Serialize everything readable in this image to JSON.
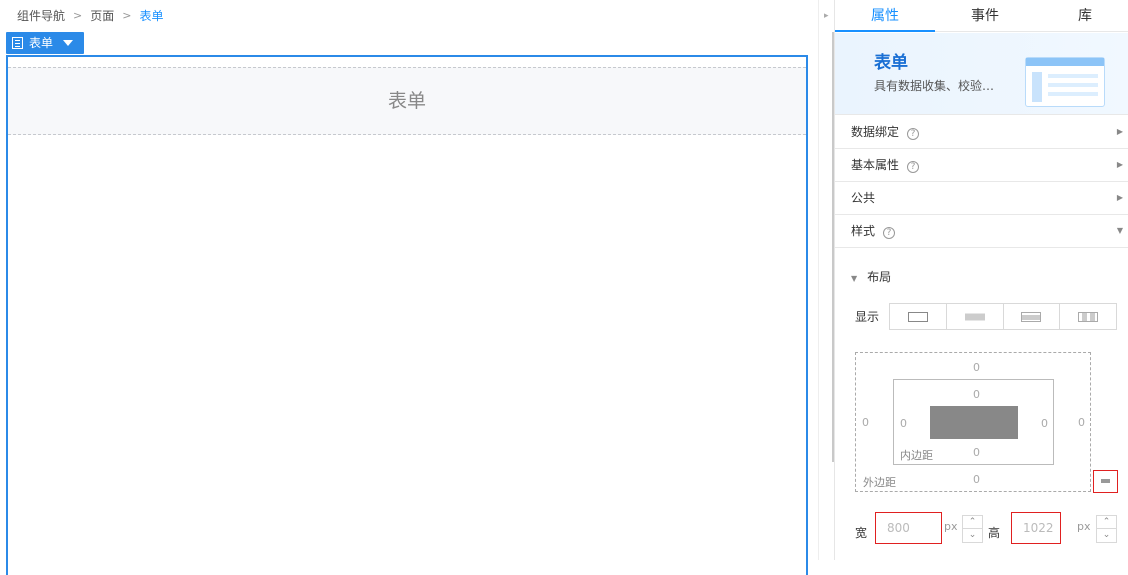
{
  "breadcrumb": {
    "items": [
      "组件导航",
      "页面",
      "表单"
    ]
  },
  "component_tag": {
    "label": "表单"
  },
  "canvas": {
    "form_title": "表单"
  },
  "panel": {
    "tabs": [
      "属性",
      "事件",
      "库"
    ],
    "active_tab": "属性",
    "banner": {
      "title": "表单",
      "desc": "具有数据收集、校验…"
    },
    "sections": [
      {
        "label": "数据绑定",
        "help": true,
        "expanded": false
      },
      {
        "label": "基本属性",
        "help": true,
        "expanded": false
      },
      {
        "label": "公共",
        "help": false,
        "expanded": false
      },
      {
        "label": "样式",
        "help": true,
        "expanded": true
      }
    ],
    "layout": {
      "title": "布局",
      "display_label": "显示",
      "margin": {
        "label": "外边距",
        "top": "0",
        "right": "0",
        "bottom": "0",
        "left": "0"
      },
      "padding": {
        "label": "内边距",
        "top": "0",
        "right": "0",
        "bottom": "0",
        "left": "0"
      },
      "width": {
        "label": "宽",
        "value": "800",
        "unit": "px"
      },
      "height": {
        "label": "高",
        "value": "1022",
        "unit": "px"
      }
    }
  },
  "colors": {
    "accent": "#1890ff",
    "tag_bg": "#2b8ae8",
    "highlight": "#e02020"
  },
  "icons": {
    "breadcrumb_sep": "chevron-right-icon",
    "tag": "form-icon",
    "tag_caret": "caret-down-icon",
    "help": "question-circle-icon",
    "collapse": "chevron-right-icon",
    "expand": "chevron-down-icon",
    "lock": "lock-icon",
    "display_modes": [
      "block-icon",
      "inline-icon",
      "inline-block-icon",
      "flex-icon"
    ]
  }
}
